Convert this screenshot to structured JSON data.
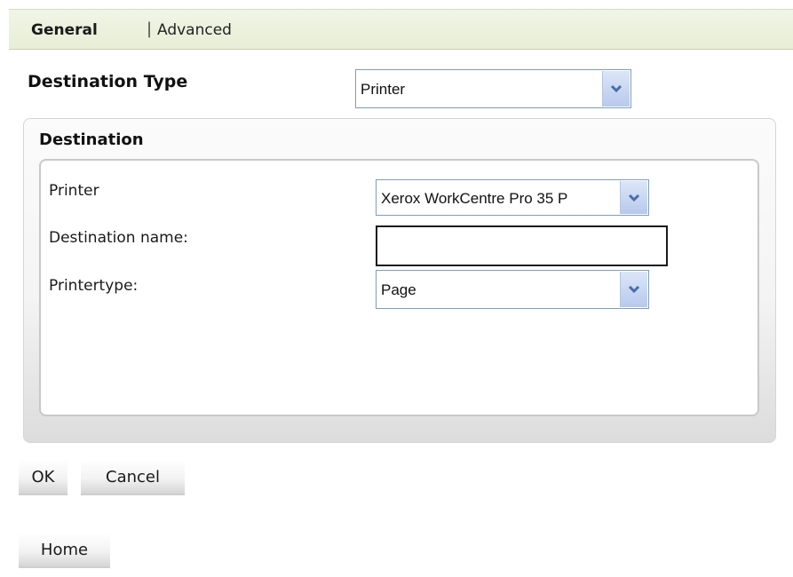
{
  "tabs": {
    "general": "General",
    "separator": "|",
    "advanced": "Advanced"
  },
  "destination_type": {
    "label": "Destination Type",
    "value": "Printer"
  },
  "destination_section": {
    "title": "Destination",
    "printer_label": "Printer",
    "printer_value": "Xerox WorkCentre Pro 35 P",
    "name_label": "Destination name:",
    "name_value": "",
    "printertype_label": "Printertype:",
    "printertype_value": "Page"
  },
  "buttons": {
    "ok": "OK",
    "cancel": "Cancel",
    "home": "Home"
  },
  "colors": {
    "tab_bar": "#e9efd9",
    "select_border": "#7f9db9",
    "select_arrow": "#4a6ea8"
  },
  "icons": {
    "dropdown": "chevron-down-icon"
  }
}
